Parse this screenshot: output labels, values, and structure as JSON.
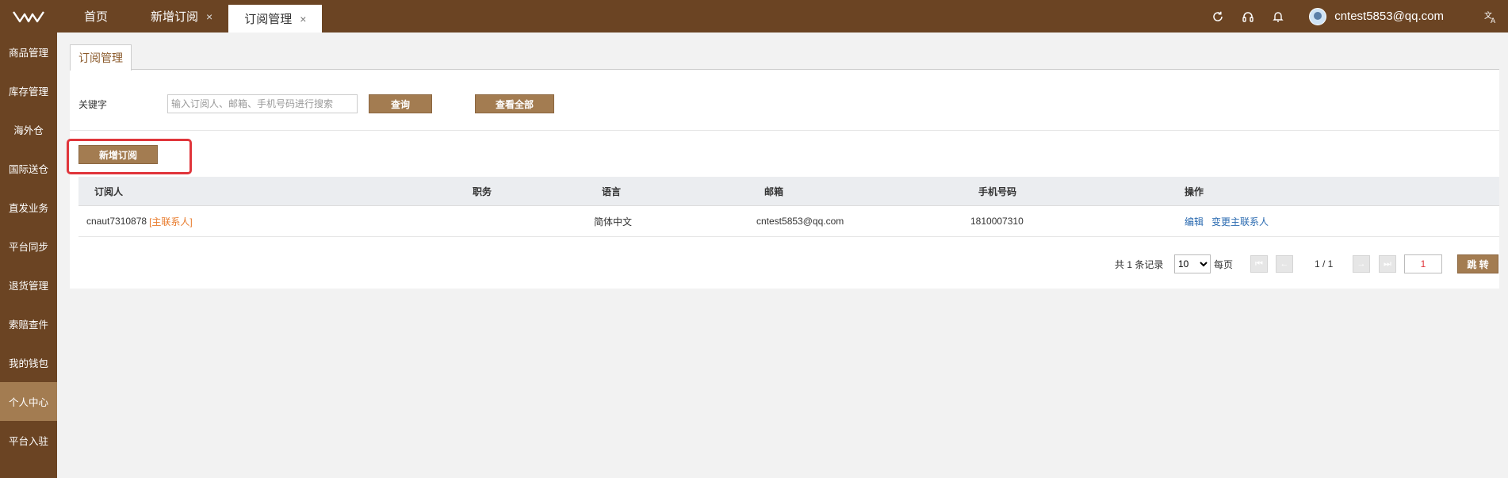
{
  "header": {
    "tabs": [
      {
        "label": "首页"
      },
      {
        "label": "新增订阅"
      },
      {
        "label": "订阅管理"
      }
    ],
    "close_symbol": "×",
    "icons": [
      "refresh-icon",
      "headset-icon",
      "bell-icon",
      "translate-icon"
    ],
    "user_email": "cntest5853@qq.com"
  },
  "sidebar": {
    "items": [
      {
        "label": "商品管理"
      },
      {
        "label": "库存管理"
      },
      {
        "label": "海外仓"
      },
      {
        "label": "国际送仓"
      },
      {
        "label": "直发业务"
      },
      {
        "label": "平台同步"
      },
      {
        "label": "退货管理"
      },
      {
        "label": "索赔查件"
      },
      {
        "label": "我的钱包"
      },
      {
        "label": "个人中心"
      },
      {
        "label": "平台入驻"
      }
    ],
    "active": "个人中心"
  },
  "page": {
    "tab_label": "订阅管理",
    "search": {
      "label": "关键字",
      "placeholder": "输入订阅人、邮箱、手机号码进行搜索",
      "value": "",
      "query_label": "查询",
      "view_all_label": "查看全部"
    },
    "add_label": "新增订阅"
  },
  "table": {
    "columns": [
      "订阅人",
      "职务",
      "语言",
      "邮箱",
      "手机号码",
      "操作"
    ],
    "rows": [
      {
        "subscriber": "cnaut7310878",
        "tag": "[主联系人]",
        "position": "",
        "language": "简体中文",
        "email": "cntest5853@qq.com",
        "phone": "1810007310",
        "actions": [
          "编辑",
          "变更主联系人"
        ]
      }
    ]
  },
  "pager": {
    "total_text": "共 1 条记录",
    "page_size": "10",
    "per_page_label": "每页",
    "page_info": "1 / 1",
    "jump_value": "1",
    "jump_label": "跳 转"
  },
  "colors": {
    "brand": "#6b4423",
    "button": "#a37c51",
    "highlight": "#e0353b",
    "tag": "#e87b2c",
    "link": "#2a6ab0"
  }
}
